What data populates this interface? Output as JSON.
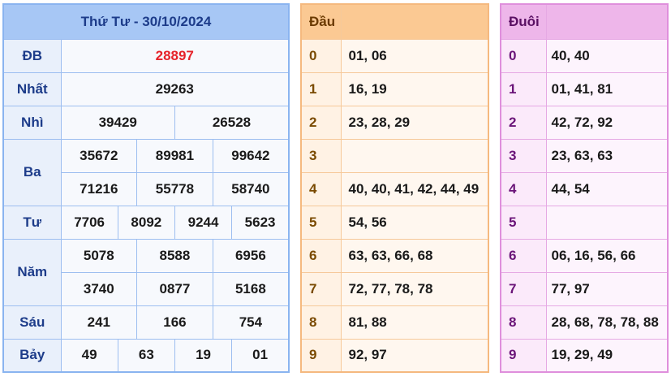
{
  "results": {
    "title": "Thứ Tư - 30/10/2024",
    "db": {
      "label": "ĐB",
      "values": [
        "28897"
      ]
    },
    "nhat": {
      "label": "Nhất",
      "values": [
        "29263"
      ]
    },
    "nhi": {
      "label": "Nhì",
      "values": [
        "39429",
        "26528"
      ]
    },
    "ba": {
      "label": "Ba",
      "values": [
        "35672",
        "89981",
        "99642",
        "71216",
        "55778",
        "58740"
      ]
    },
    "tu": {
      "label": "Tư",
      "values": [
        "7706",
        "8092",
        "9244",
        "5623"
      ]
    },
    "nam": {
      "label": "Năm",
      "values": [
        "5078",
        "8588",
        "6956",
        "3740",
        "0877",
        "5168"
      ]
    },
    "sau": {
      "label": "Sáu",
      "values": [
        "241",
        "166",
        "754"
      ]
    },
    "bay": {
      "label": "Bảy",
      "values": [
        "49",
        "63",
        "19",
        "01"
      ]
    }
  },
  "dau": {
    "header": "Đầu",
    "rows": [
      {
        "k": "0",
        "v": "01, 06"
      },
      {
        "k": "1",
        "v": "16, 19"
      },
      {
        "k": "2",
        "v": "23, 28, 29"
      },
      {
        "k": "3",
        "v": ""
      },
      {
        "k": "4",
        "v": "40, 40, 41, 42, 44, 49"
      },
      {
        "k": "5",
        "v": "54, 56"
      },
      {
        "k": "6",
        "v": "63, 63, 66, 68"
      },
      {
        "k": "7",
        "v": "72, 77, 78, 78"
      },
      {
        "k": "8",
        "v": "81, 88"
      },
      {
        "k": "9",
        "v": "92, 97"
      }
    ]
  },
  "duoi": {
    "header": "Đuôi",
    "rows": [
      {
        "k": "0",
        "v": "40, 40"
      },
      {
        "k": "1",
        "v": "01, 41, 81"
      },
      {
        "k": "2",
        "v": "42, 72, 92"
      },
      {
        "k": "3",
        "v": "23, 63, 63"
      },
      {
        "k": "4",
        "v": "44, 54"
      },
      {
        "k": "5",
        "v": ""
      },
      {
        "k": "6",
        "v": "06, 16, 56, 66"
      },
      {
        "k": "7",
        "v": "77, 97"
      },
      {
        "k": "8",
        "v": "28, 68, 78, 78, 88"
      },
      {
        "k": "9",
        "v": "19, 29, 49"
      }
    ]
  },
  "colors": {
    "special_prize": "#e6232a",
    "results_header": "#a7c7f5",
    "dau_header": "#fbc993",
    "duoi_header": "#eeb6ea"
  }
}
